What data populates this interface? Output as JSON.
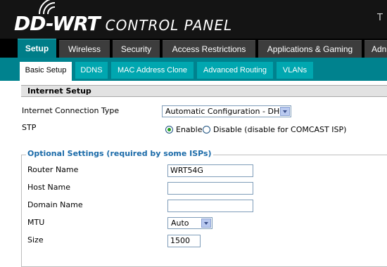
{
  "header": {
    "logo_mark": "DD-WRT",
    "title": "CONTROL PANEL",
    "corner_text": "T"
  },
  "tabs": [
    {
      "label": "Setup",
      "active": true
    },
    {
      "label": "Wireless"
    },
    {
      "label": "Security"
    },
    {
      "label": "Access Restrictions"
    },
    {
      "label": "Applications & Gaming"
    },
    {
      "label": "Adn"
    }
  ],
  "subtabs": [
    {
      "label": "Basic Setup",
      "active": true
    },
    {
      "label": "DDNS"
    },
    {
      "label": "MAC Address Clone"
    },
    {
      "label": "Advanced Routing"
    },
    {
      "label": "VLANs"
    }
  ],
  "internet_setup": {
    "title": "Internet Setup",
    "connection_type_label": "Internet Connection Type",
    "connection_type_value": "Automatic Configuration - DHCP",
    "stp_label": "STP",
    "stp_enable": "Enable",
    "stp_disable": "Disable (disable for COMCAST ISP)",
    "stp_selected": "Enable"
  },
  "optional": {
    "legend": "Optional Settings (required by some ISPs)",
    "router_name_label": "Router Name",
    "router_name_value": "WRT54G",
    "host_name_label": "Host Name",
    "host_name_value": "",
    "domain_name_label": "Domain Name",
    "domain_name_value": "",
    "mtu_label": "MTU",
    "mtu_value": "Auto",
    "size_label": "Size",
    "size_value": "1500"
  },
  "colors": {
    "header_bg": "#141414",
    "active_tab": "#007d88",
    "subtab_bar": "#00828e",
    "subtab": "#00a7b0",
    "legend_text": "#1a6aa8"
  }
}
